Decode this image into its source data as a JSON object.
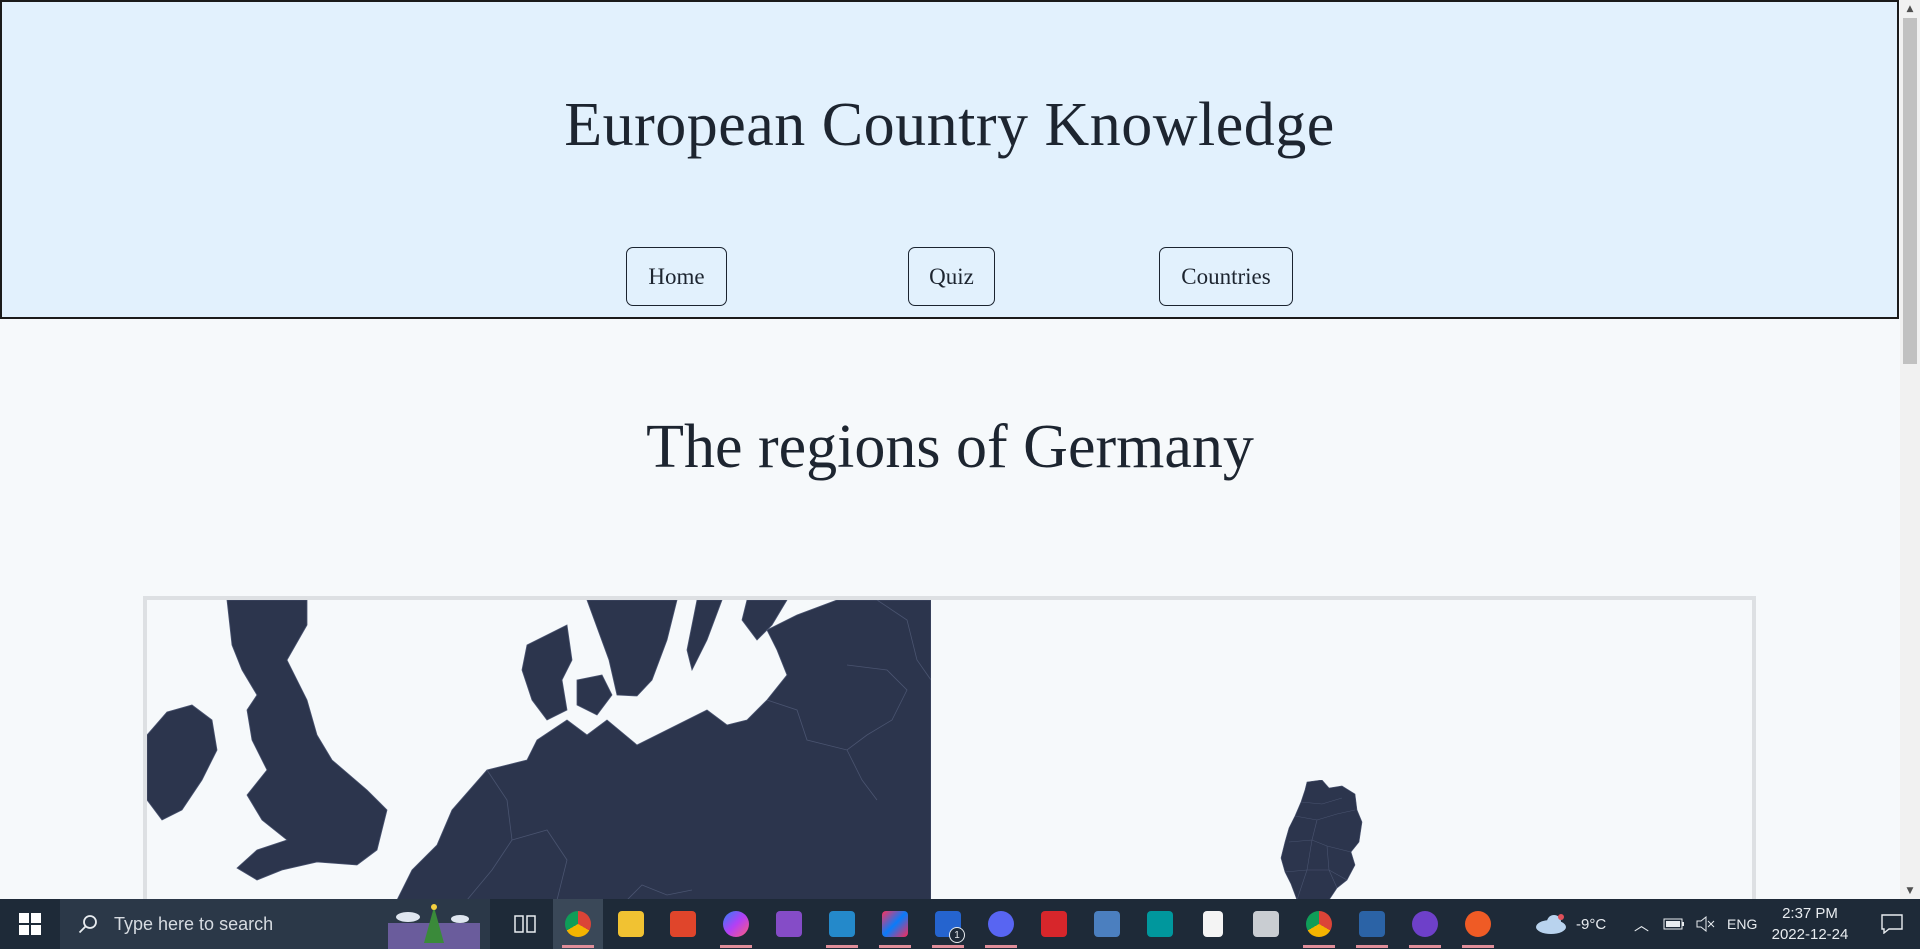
{
  "header": {
    "site_title": "European Country Knowledge",
    "nav": [
      {
        "label": "Home"
      },
      {
        "label": "Quiz"
      },
      {
        "label": "Countries"
      }
    ]
  },
  "main": {
    "region_title": "The regions of Germany"
  },
  "taskbar": {
    "search_placeholder": "Type here to search",
    "apps": [
      "chrome-icon",
      "file-explorer-icon",
      "office-icon",
      "messenger-icon",
      "visual-studio-icon",
      "vscode-icon",
      "intellij-icon",
      "todo-icon",
      "discord-icon",
      "app-red-icon",
      "network-app-icon",
      "arduino-icon",
      "file-icon",
      "photos-icon",
      "chrome-icon",
      "powershell-icon",
      "github-icon",
      "postman-icon"
    ],
    "todo_badge": "1",
    "weather": "-9°C",
    "language": "ENG",
    "time": "2:37 PM",
    "date": "2022-12-24"
  },
  "colors": {
    "header_bg": "#e2f1fd",
    "page_bg": "#f6f9fb",
    "map_land": "#2c354d",
    "taskbar_bg": "#1e2a38"
  }
}
